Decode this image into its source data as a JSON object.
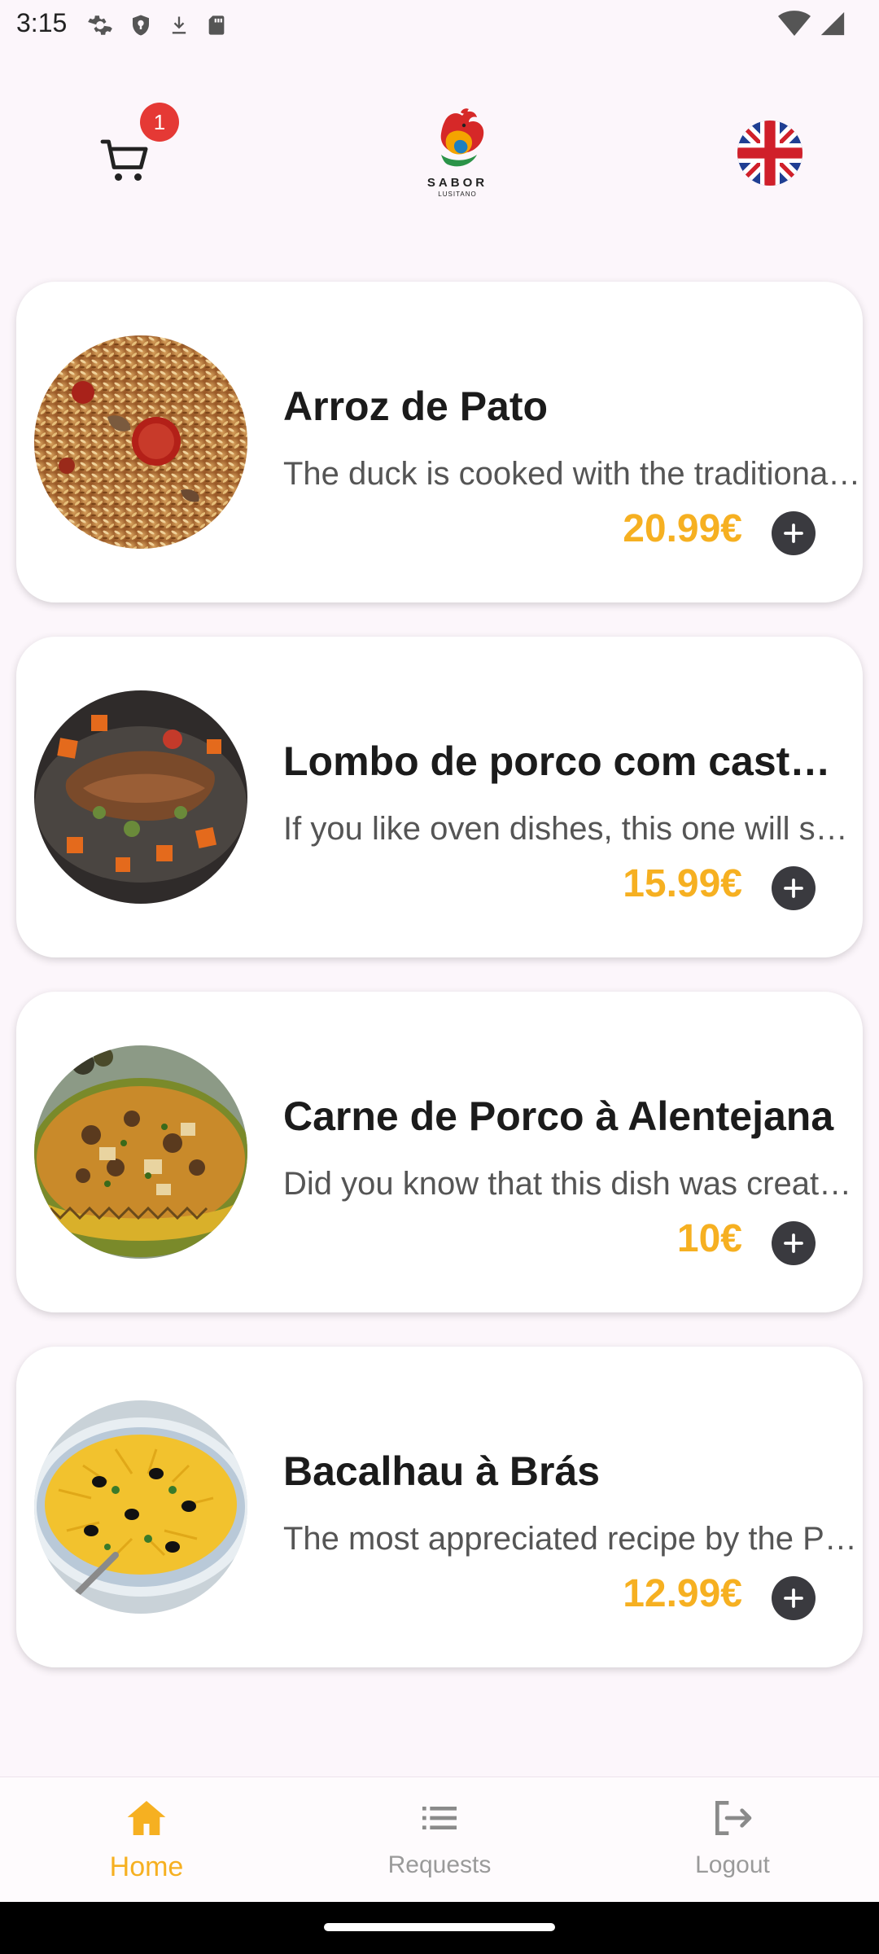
{
  "status_bar": {
    "time": "3:15",
    "left_icons": [
      "gear-icon",
      "shield-icon",
      "download-icon",
      "sd-card-icon"
    ],
    "right_icons": [
      "wifi-icon",
      "signal-icon"
    ]
  },
  "header": {
    "cart_count": "1",
    "logo_text": "SABOR",
    "logo_subtext": "LUSITANO",
    "language_flag": "uk-flag"
  },
  "menu": {
    "items": [
      {
        "title": "Arroz de Pato",
        "description": "The duck is cooked with the traditional Portuguese touch",
        "price": "20.99€"
      },
      {
        "title": "Lombo de porco com castanhas",
        "description": "If you like oven dishes, this one will surprise you",
        "price": "15.99€"
      },
      {
        "title": "Carne de Porco à Alentejana",
        "description": "Did you know that this dish was created in the Algarve",
        "price": "10€"
      },
      {
        "title": "Bacalhau à Brás",
        "description": "The most appreciated recipe by the Portuguese",
        "price": "12.99€"
      }
    ]
  },
  "bottom_nav": {
    "items": [
      {
        "label": "Home",
        "icon": "home-icon",
        "active": true
      },
      {
        "label": "Requests",
        "icon": "list-icon",
        "active": false
      },
      {
        "label": "Logout",
        "icon": "logout-icon",
        "active": false
      }
    ]
  },
  "colors": {
    "background": "#fcf6fb",
    "accent": "#f6b021",
    "badge": "#e53935",
    "add_button": "#3a3a3f"
  }
}
